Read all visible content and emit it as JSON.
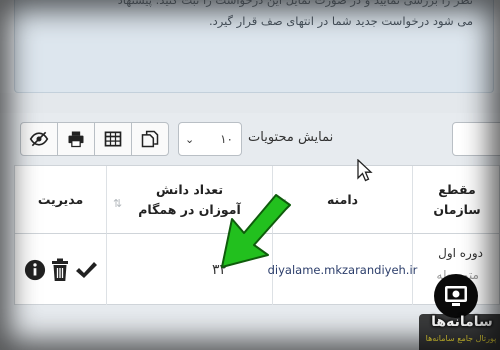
{
  "notice": {
    "line1": "نظر را بررسی نمایید و در صورت تمایل این درخواست را ثبت کنید. پیشنهاد",
    "line2": "می شود درخواست جدید شما در انتهای صف قرار گیرد."
  },
  "toolbar": {
    "buttons": [
      "visibility-icon",
      "print-icon",
      "table-icon",
      "copy-icon"
    ]
  },
  "page_size": {
    "value": "۱۰"
  },
  "show_entries_label": "نمایش محتویات",
  "table": {
    "headers": {
      "manage": "مدیریت",
      "count": "تعداد دانش آموزان در همگام",
      "domain": "دامنه",
      "level": "مقطع سازمان"
    },
    "row": {
      "count": "۳۲",
      "domain": "diyalame.mkzarandiyeh.ir",
      "level": "دوره اول",
      "level_sub": "متوسطه"
    },
    "actions": [
      "info-icon",
      "delete-icon",
      "check-icon"
    ]
  },
  "watermark": {
    "name": "سامانه‌ها",
    "subtitle": "پورتال جامع سامانه‌ها"
  },
  "colors": {
    "arrow": "#22c01e",
    "domain_text": "#2c3e6b",
    "notice_bg": "#dde6ee"
  }
}
